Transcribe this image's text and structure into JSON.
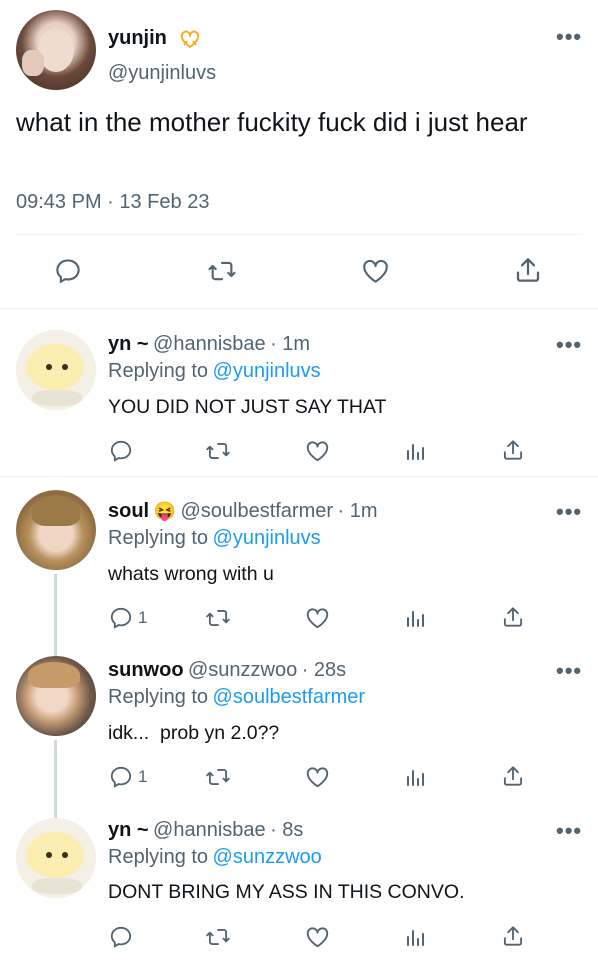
{
  "main_tweet": {
    "display_name": "yunjin",
    "handle": "@yunjinluvs",
    "text": "what in the mother fuckity fuck did i just hear",
    "timestamp": "09:43 PM · 13 Feb 23",
    "more_label": "•••"
  },
  "replies": [
    {
      "display_name": "yn ~",
      "handle": "@hannisbae",
      "time": "· 1m",
      "replying_prefix": "Replying to",
      "replying_to": "@yunjinluvs",
      "text": "YOU DID NOT JUST SAY THAT",
      "reply_count": ""
    },
    {
      "display_name": "soul",
      "emoji": "😝",
      "handle": "@soulbestfarmer",
      "time": "· 1m",
      "replying_prefix": "Replying to",
      "replying_to": "@yunjinluvs",
      "text": "whats wrong with u",
      "reply_count": "1"
    },
    {
      "display_name": "sunwoo",
      "handle": "@sunzzwoo",
      "time": "· 28s",
      "replying_prefix": "Replying to",
      "replying_to": "@soulbestfarmer",
      "text": "idk...  prob yn 2.0??",
      "reply_count": "1"
    },
    {
      "display_name": "yn ~",
      "handle": "@hannisbae",
      "time": "· 8s",
      "replying_prefix": "Replying to",
      "replying_to": "@sunzzwoo",
      "text": "DONT BRING MY ASS IN THIS CONVO.",
      "reply_count": ""
    }
  ],
  "icons": {
    "reply": "reply-icon",
    "retweet": "retweet-icon",
    "like": "like-icon",
    "share": "share-icon",
    "analytics": "analytics-icon",
    "more": "more-icon"
  },
  "colors": {
    "text": "#0f1419",
    "secondary": "#536471",
    "link": "#1d9bf0",
    "divider": "#eff3f4"
  }
}
